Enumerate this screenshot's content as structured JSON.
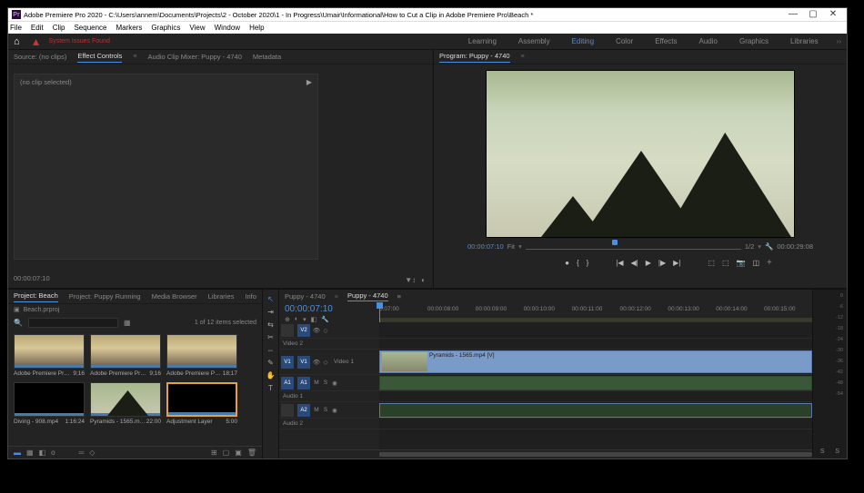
{
  "titlebar": {
    "icon_letter": "Pr",
    "title": "Adobe Premiere Pro 2020 - C:\\Users\\annem\\Documents\\Projects\\2 - October 2020\\1 - In Progress\\Umair\\Informational\\How to Cut a Clip in Adobe Premiere Pro\\Beach *"
  },
  "menu": [
    "File",
    "Edit",
    "Clip",
    "Sequence",
    "Markers",
    "Graphics",
    "View",
    "Window",
    "Help"
  ],
  "warning_text": "System Issues Found",
  "workspaces": {
    "items": [
      "Learning",
      "Assembly",
      "Editing",
      "Color",
      "Effects",
      "Audio",
      "Graphics",
      "Libraries"
    ],
    "active": "Editing"
  },
  "source_panel": {
    "tabs": [
      "Source: (no clips)",
      "Effect Controls",
      "Audio Clip Mixer: Puppy - 4740",
      "Metadata"
    ],
    "active": "Effect Controls",
    "noclip": "(no clip selected)",
    "timecode": "00:00:07:10"
  },
  "program_panel": {
    "tab": "Program: Puppy - 4740",
    "timecode": "00:00:07:10",
    "fit": "Fit",
    "zoom": "1/2",
    "duration": "00:00:29:08"
  },
  "project_panel": {
    "tabs": [
      "Project: Beach",
      "Project: Puppy Running",
      "Media Browser",
      "Libraries",
      "Info"
    ],
    "active": "Project: Beach",
    "sub": "Beach.prproj",
    "count": "1 of 12 items selected",
    "bins": [
      {
        "name": "Adobe Premiere Pro 2...",
        "dur": "9;16",
        "thumb": "sky"
      },
      {
        "name": "Adobe Premiere Pro 2...",
        "dur": "9;16",
        "thumb": "sky"
      },
      {
        "name": "Adobe Premiere Pro 2...",
        "dur": "18;17",
        "thumb": "sky"
      },
      {
        "name": "Diving - 908.mp4",
        "dur": "1:16:24",
        "thumb": "black"
      },
      {
        "name": "Pyramids - 1565.mp4",
        "dur": "22:00",
        "thumb": "pyr"
      },
      {
        "name": "Adjustment Layer",
        "dur": "5:00",
        "thumb": "black",
        "selected": true
      }
    ]
  },
  "timeline": {
    "tabs": [
      "Puppy - 4740",
      "Puppy - 4740"
    ],
    "timecode": "00:00:07:10",
    "ruler_ticks": [
      "0:07:00",
      "00:00:08:00",
      "00:00:09:00",
      "00:00:10:00",
      "00:00:11:00",
      "00:00:12:00",
      "00:00:13:00",
      "00:00:14:00",
      "00:00:15:00"
    ],
    "tracks": {
      "v2": "Video 2",
      "v1": "Video 1",
      "a1": "Audio 1",
      "a2": "Audio 2"
    },
    "clip_name": "Pyramids - 1565.mp4 [V]"
  },
  "meter_scale": [
    "0",
    "-6",
    "-12",
    "-18",
    "-24",
    "-30",
    "-36",
    "-42",
    "-48",
    "-54"
  ]
}
